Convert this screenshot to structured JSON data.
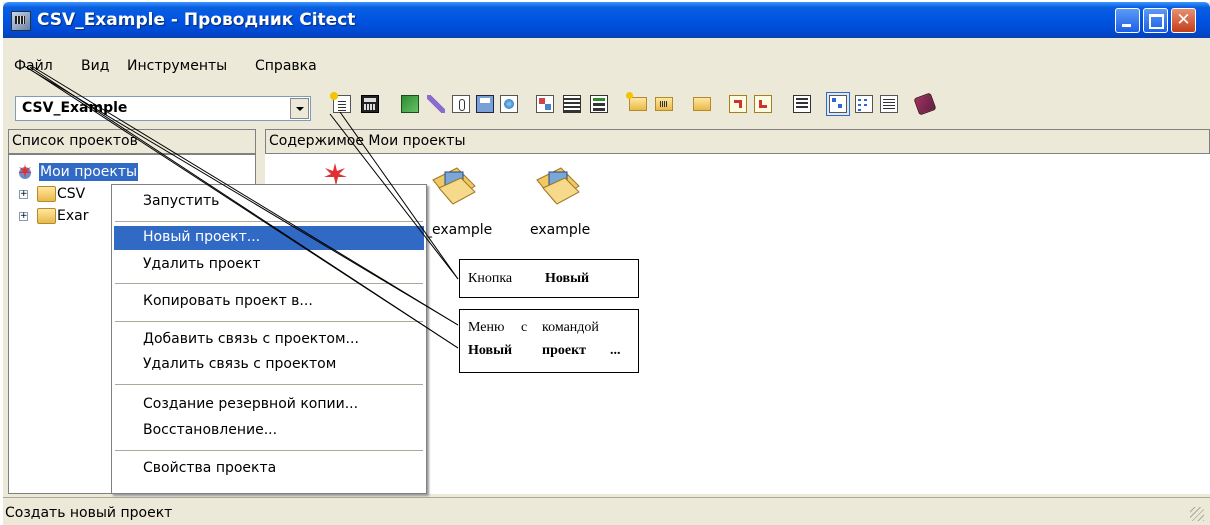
{
  "window": {
    "title": "CSV_Example - Проводник Citect"
  },
  "menu": {
    "file": "Файл",
    "view": "Вид",
    "tools": "Инструменты",
    "help": "Справка"
  },
  "toolbar": {
    "project_combo_value": "CSV_Example",
    "icons": [
      "new-project-icon",
      "compile-icon",
      "run-icon",
      "edit-icon",
      "properties-icon",
      "save-icon",
      "browse-icon",
      "graphics-icon",
      "project-editor-icon",
      "cicode-editor-icon",
      "new-folder-icon",
      "open-icon",
      "folder-icon",
      "backup-icon",
      "restore-icon",
      "settings-icon",
      "large-icons-icon",
      "small-icons-icon",
      "details-icon",
      "help-book-icon"
    ]
  },
  "left_pane": {
    "header": "Список проектов",
    "tree": [
      {
        "label": "Мои проекты",
        "selected": true
      },
      {
        "label": "CSV"
      },
      {
        "label": "Exar"
      }
    ]
  },
  "right_pane": {
    "header": "Содержимое Мои проекты",
    "items": [
      {
        "label": "_example"
      },
      {
        "label": "example"
      }
    ]
  },
  "context_menu": {
    "items": [
      "Запустить",
      "Новый проект...",
      "Удалить проект",
      "Копировать проект в...",
      "Добавить связь с проектом...",
      "Удалить связь с проектом",
      "Создание резервной копии...",
      "Восстановление...",
      "Свойства проекта"
    ],
    "selected_index": 1
  },
  "status_bar": {
    "text": "Создать новый проект"
  },
  "callouts": {
    "new_button": {
      "word1": "Кнопка",
      "word2": "Новый"
    },
    "menu": {
      "line1_word1": "Меню",
      "line1_word2": "с",
      "line1_word3": "командой",
      "line2_word1": "Новый",
      "line2_word2": "проект",
      "line2_word3": "..."
    }
  },
  "colors": {
    "titlebar": "#0054e3",
    "selection": "#316ac5",
    "face": "#ece9d8"
  }
}
